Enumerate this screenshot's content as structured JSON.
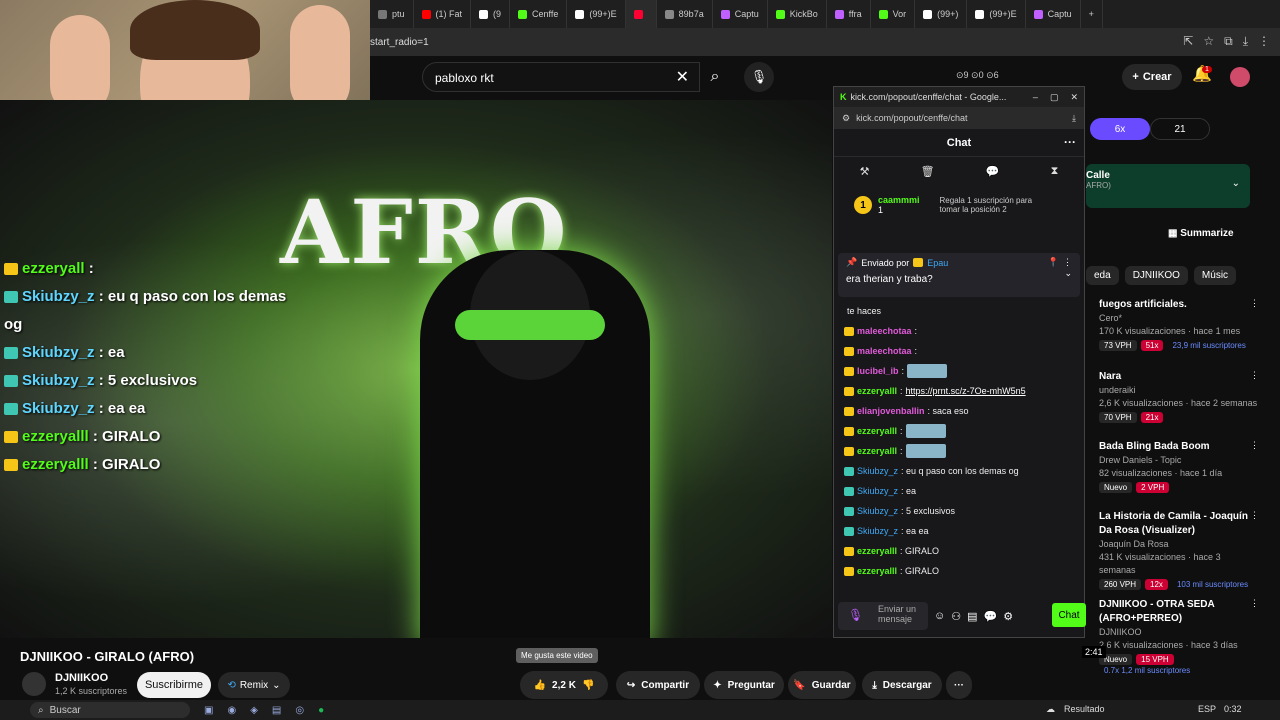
{
  "browser": {
    "tabs": [
      {
        "label": "ptu",
        "color": "#777"
      },
      {
        "label": "(1) Fat",
        "color": "#ff0000"
      },
      {
        "label": "(9",
        "color": "#ffffff"
      },
      {
        "label": "Cenffe",
        "color": "#53fc18"
      },
      {
        "label": "(99+)E",
        "color": "#ffffff"
      },
      {
        "label": "",
        "color": "#ff0033"
      },
      {
        "label": "89b7a",
        "color": "#888"
      },
      {
        "label": "Captu",
        "color": "#c060ff"
      },
      {
        "label": "KickBo",
        "color": "#53fc18"
      },
      {
        "label": "ffra",
        "color": "#c060ff"
      },
      {
        "label": "Vor",
        "color": "#53fc18"
      },
      {
        "label": "(99+)",
        "color": "#ffffff"
      },
      {
        "label": "(99+)E",
        "color": "#ffffff"
      },
      {
        "label": "Captu",
        "color": "#c060ff"
      }
    ],
    "url": "start_radio=1"
  },
  "yt_header": {
    "search_value": "pabloxo rkt",
    "stats": "⊙9 ⊙0 ⊙6",
    "create_label": "Crear",
    "notif_count": "1"
  },
  "video": {
    "title_art": "AFRO"
  },
  "overlay_chat": [
    {
      "user": "ezzeryall",
      "text": " :",
      "badge": "gold"
    },
    {
      "user": "Skiubzy_z",
      "text": " : eu q paso con los demas og",
      "badge": "teal"
    },
    {
      "user": "Skiubzy_z",
      "text": " : ea",
      "badge": "teal"
    },
    {
      "user": "Skiubzy_z",
      "text": " : 5 exclusivos",
      "badge": "teal"
    },
    {
      "user": "Skiubzy_z",
      "text": " : ea ea",
      "badge": "teal"
    },
    {
      "user": "ezzeryalll",
      "text": " : GIRALO",
      "badge": "gold"
    },
    {
      "user": "ezzeryalll",
      "text": " : GIRALO",
      "badge": "gold"
    }
  ],
  "popup": {
    "window_title": "kick.com/popout/cenffe/chat - Google...",
    "url": "kick.com/popout/cenffe/chat",
    "chat_title": "Chat",
    "leader_user": "caammmi",
    "leader_count": "1",
    "leader_hint": "Regala 1 suscripción para tomar la posición 2",
    "pinned_by_label": "Enviado por",
    "pinned_by_user": "Epau",
    "pinned_message": "era therian y traba?",
    "messages": [
      {
        "user": "",
        "text": "te haces",
        "style": "plain"
      },
      {
        "user": "maleechotaa",
        "text": ":",
        "style": "pink"
      },
      {
        "user": "maleechotaa",
        "text": ":",
        "style": "pink"
      },
      {
        "user": "lucibel_ib",
        "text": ":",
        "style": "pink",
        "emote": true
      },
      {
        "user": "ezzeryalll",
        "text": ": ",
        "link": "https://prnt.sc/z-7Oe-mhW5n5",
        "style": "green"
      },
      {
        "user": "elianjovenballin",
        "text": ": saca eso",
        "style": "pink"
      },
      {
        "user": "ezzeryalll",
        "text": ":",
        "style": "green",
        "emote": true
      },
      {
        "user": "ezzeryalll",
        "text": ":",
        "style": "green",
        "emote": true
      },
      {
        "user": "Skiubzy_z",
        "text": ": eu q paso con los demas og",
        "style": "blue"
      },
      {
        "user": "Skiubzy_z",
        "text": ": ea",
        "style": "blue"
      },
      {
        "user": "Skiubzy_z",
        "text": ": 5 exclusivos",
        "style": "blue"
      },
      {
        "user": "Skiubzy_z",
        "text": ": ea ea",
        "style": "blue"
      },
      {
        "user": "ezzeryalll",
        "text": ": GIRALO",
        "style": "green"
      },
      {
        "user": "ezzeryalll",
        "text": ": GIRALO",
        "style": "green"
      }
    ],
    "input_placeholder": "Enviar un mensaje",
    "send_label": "Chat"
  },
  "sidebar": {
    "speed_a": "6x",
    "speed_b": "21",
    "card_title": "Calle",
    "card_sub": "AFRO)",
    "summarize_label": "Summarize",
    "chips": [
      "eda",
      "DJNIIKOO",
      "Músic"
    ],
    "recs": [
      {
        "title": "fuegos artificiales.",
        "channel": "Cero*",
        "meta": "170 K visualizaciones · hace 1 mes",
        "vph": "73 VPH",
        "mult": "51x",
        "extra": "23,9 mil suscriptores"
      },
      {
        "title": "Nara",
        "channel": "underaiki",
        "meta": "2,6 K visualizaciones · hace 2 semanas",
        "vph": "70 VPH",
        "mult": "21x",
        "extra": ""
      },
      {
        "title": "Bada Bling Bada Boom",
        "channel": "Drew Daniels - Topic",
        "meta": "82 visualizaciones · hace 1 día",
        "vph": "Nuevo",
        "mult": "2 VPH",
        "extra": ""
      },
      {
        "title": "La Historia de Camila - Joaquín Da Rosa (Visualizer)",
        "channel": "Joaquín Da Rosa",
        "meta": "431 K visualizaciones · hace 3 semanas",
        "vph": "260 VPH",
        "mult": "12x",
        "extra": "103 mil suscriptores"
      },
      {
        "title": "DJNIIKOO - OTRA SEDA (AFRO+PERREO)",
        "channel": "DJNIIKOO",
        "meta": "2,6 K visualizaciones · hace 3 días",
        "vph": "Nuevo",
        "mult": "15 VPH",
        "extra": "0.7x   1,2 mil suscriptores"
      }
    ],
    "duration": "2:41"
  },
  "below_video": {
    "title": "DJNIIKOO - GIRALO (AFRO)",
    "channel": "DJNIIKOO",
    "subs": "1,2 K suscriptores",
    "subscribe_label": "Suscribirme",
    "remix_label": "Remix",
    "like_count": "2,2 K",
    "tooltip": "Me gusta este video",
    "share_label": "Compartir",
    "ask_label": "Preguntar",
    "save_label": "Guardar",
    "download_label": "Descargar"
  },
  "taskbar": {
    "search_placeholder": "Buscar",
    "weather": "Resultado",
    "lang": "ESP",
    "time": "0:32"
  }
}
